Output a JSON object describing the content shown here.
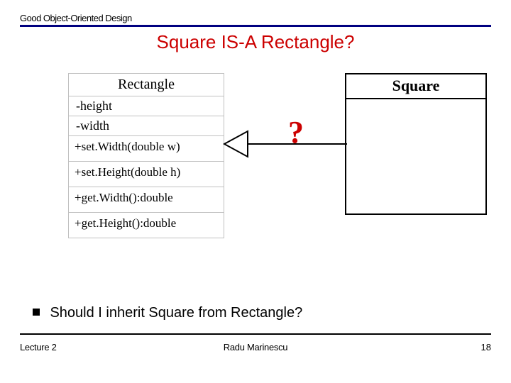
{
  "header": {
    "label": "Good Object-Oriented Design"
  },
  "title": "Square IS-A Rectangle?",
  "uml_rectangle": {
    "name": "Rectangle",
    "attrs": [
      "-height",
      "-width"
    ],
    "methods": [
      "+set.Width(double w)",
      "+set.Height(double h)",
      "+get.Width():double",
      "+get.Height():double"
    ]
  },
  "uml_square": {
    "name": "Square"
  },
  "question_mark": "?",
  "bullet": {
    "text": "Should I inherit Square from Rectangle?"
  },
  "footer": {
    "left": "Lecture 2",
    "center": "Radu Marinescu",
    "right": "18"
  }
}
